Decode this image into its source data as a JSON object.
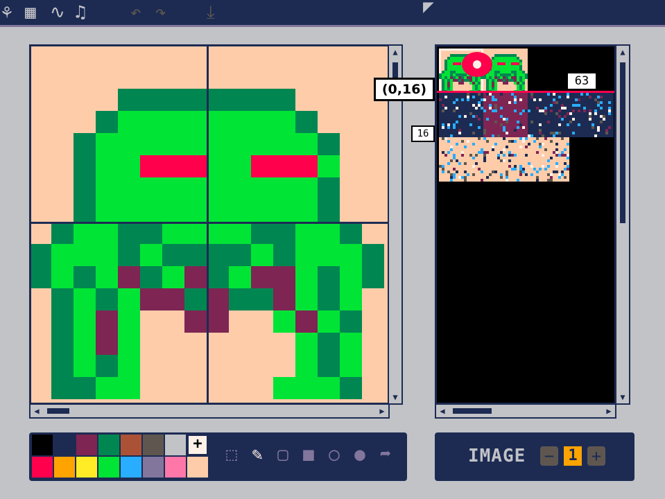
{
  "toolbar": {
    "tabs": [
      {
        "name": "sprite-tab",
        "glyph": "⚘"
      },
      {
        "name": "map-tab",
        "glyph": "▦"
      },
      {
        "name": "sfx-tab",
        "glyph": "∿"
      },
      {
        "name": "music-tab",
        "glyph": "♫"
      }
    ],
    "undo_glyph": "↶",
    "redo_glyph": "↷",
    "save_glyph": "⤓"
  },
  "colors": {
    "pico8": [
      "#000000",
      "#1d2b53",
      "#7e2553",
      "#008751",
      "#ab5236",
      "#5f574f",
      "#c2c3c7",
      "#fff1e8",
      "#ff004d",
      "#ffa300",
      "#ffec27",
      "#00e436",
      "#29adff",
      "#83769c",
      "#ff77a8",
      "#ffccaa"
    ]
  },
  "sprite_sheet": {
    "coord_label": "(0,16)",
    "sprite_number": "63",
    "row_label": "16"
  },
  "palette": {
    "selected_marker": "+"
  },
  "tools": [
    {
      "name": "select-tool",
      "glyph": "⬚"
    },
    {
      "name": "pencil-tool",
      "glyph": "✎"
    },
    {
      "name": "rect-outline-tool",
      "glyph": "▢"
    },
    {
      "name": "rect-fill-tool",
      "glyph": "■"
    },
    {
      "name": "circle-outline-tool",
      "glyph": "○"
    },
    {
      "name": "circle-fill-tool",
      "glyph": "●"
    },
    {
      "name": "stamp-tool",
      "glyph": "➦"
    }
  ],
  "image_panel": {
    "label": "IMAGE",
    "minus": "−",
    "value": "1",
    "plus": "+"
  }
}
